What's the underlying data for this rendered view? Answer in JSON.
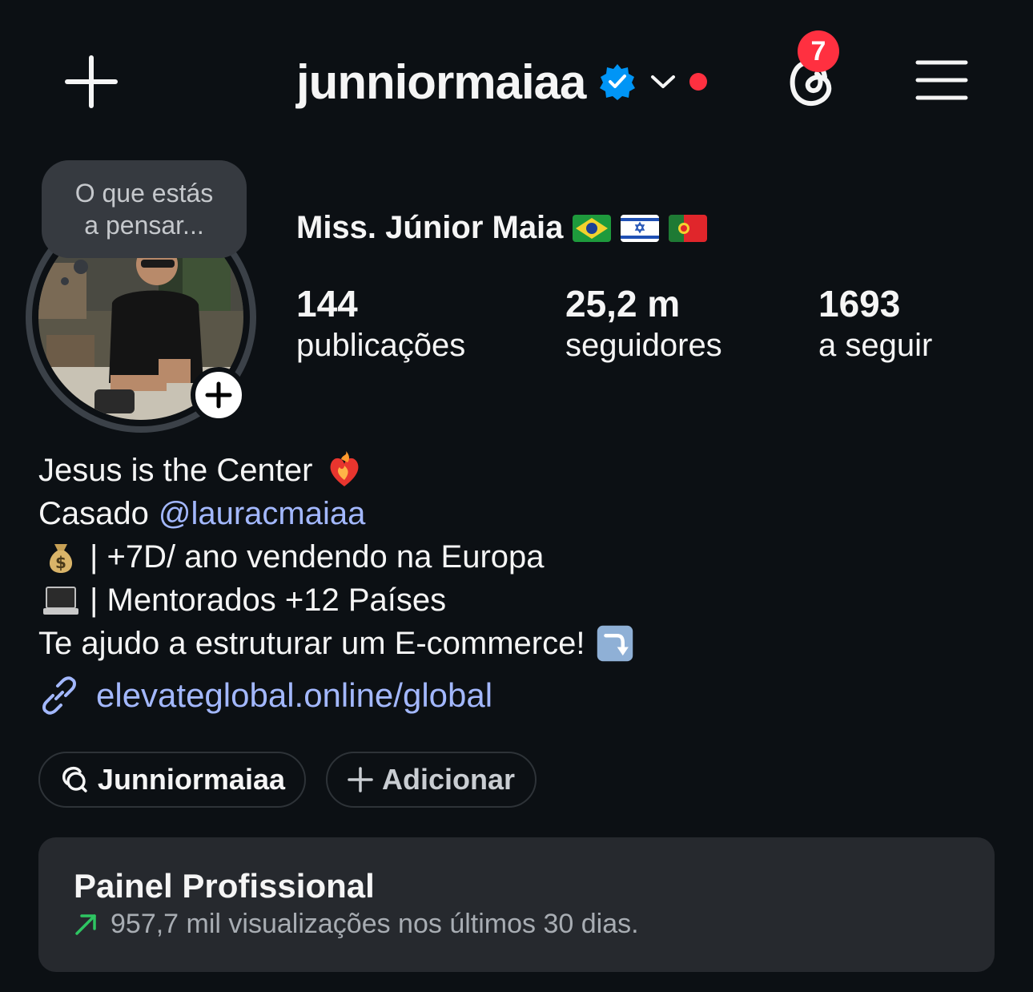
{
  "header": {
    "username": "junniormaiaa",
    "notification_count": "7",
    "icons": [
      "plus-icon",
      "verified-badge-icon",
      "chevron-down-icon",
      "threads-icon",
      "hamburger-menu-icon"
    ]
  },
  "note": {
    "line1": "O que estás",
    "line2": "a pensar..."
  },
  "profile": {
    "display_name": "Miss. Júnior Maia",
    "flags": [
      "Brazil flag",
      "Israel flag",
      "Portugal flag"
    ]
  },
  "stats": [
    {
      "value": "144",
      "label": "publicações"
    },
    {
      "value": "25,2 m",
      "label": "seguidores"
    },
    {
      "value": "1693",
      "label": "a seguir"
    }
  ],
  "bio": {
    "line1": "Jesus is the Center",
    "line2_prefix": "Casado",
    "line2_mention": "@lauracmaiaa",
    "line3": "| +7D/ ano vendendo na Europa",
    "line4": "| Mentorados +12 Países",
    "line5": "Te ajudo a estruturar um E-commerce!",
    "link": "elevateglobal.online/global"
  },
  "chips": {
    "threads": "Junniormaiaa",
    "add": "Adicionar"
  },
  "dashboard": {
    "title": "Painel Profissional",
    "subtitle": "957,7 mil visualizações nos últimos 30 dias."
  },
  "colors": {
    "background": "#0c1014",
    "link": "#a3b8ff",
    "verified": "#0095f6",
    "badge": "#ff3040",
    "card": "#26292e",
    "trend_up": "#2ec562"
  }
}
